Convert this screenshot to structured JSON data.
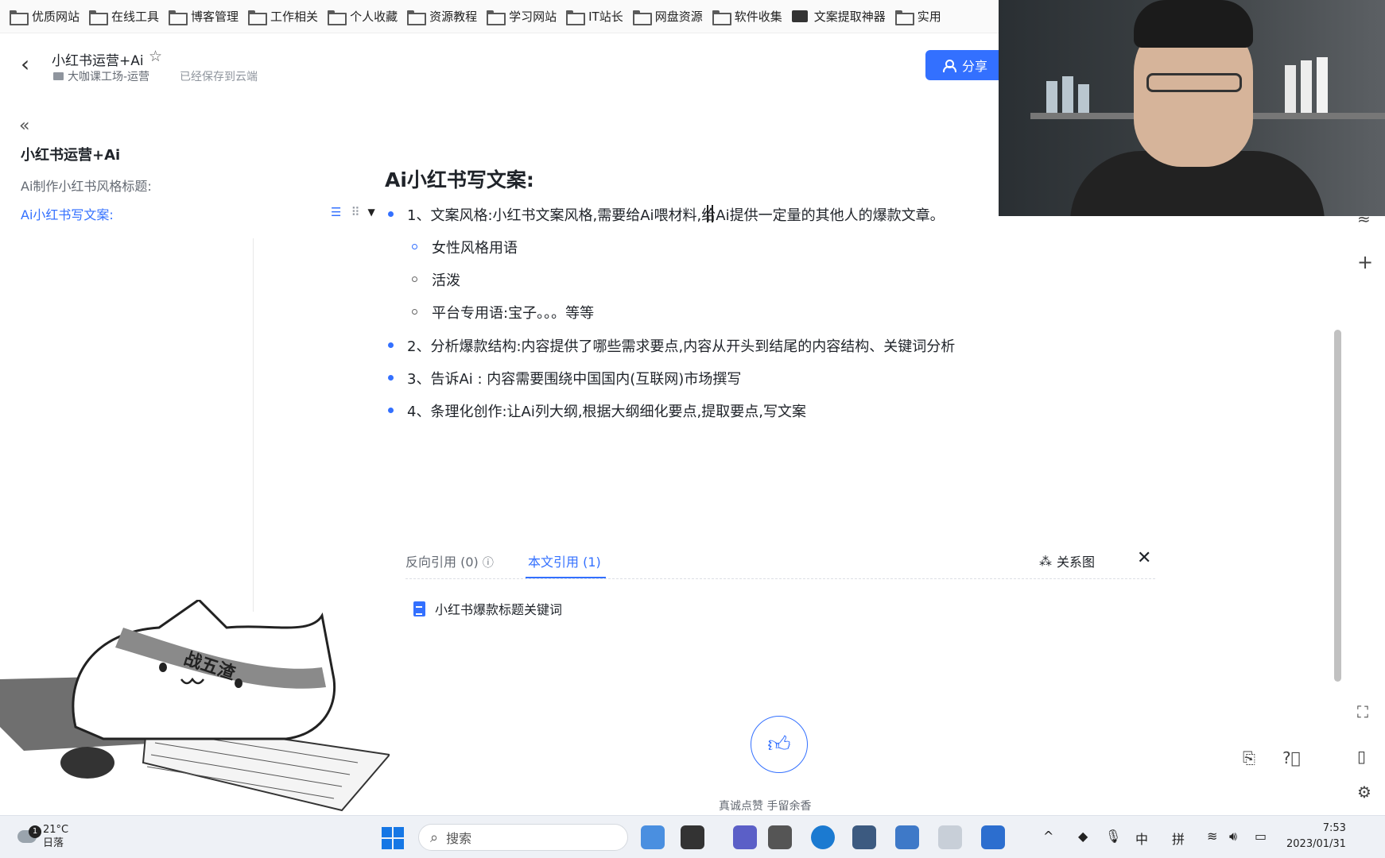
{
  "bookmarks": [
    {
      "label": "优质网站",
      "icon": "folder-icon"
    },
    {
      "label": "在线工具",
      "icon": "folder-icon"
    },
    {
      "label": "博客管理",
      "icon": "folder-icon"
    },
    {
      "label": "工作相关",
      "icon": "folder-icon"
    },
    {
      "label": "个人收藏",
      "icon": "folder-icon"
    },
    {
      "label": "资源教程",
      "icon": "folder-icon"
    },
    {
      "label": "学习网站",
      "icon": "folder-icon"
    },
    {
      "label": "IT站长",
      "icon": "folder-icon"
    },
    {
      "label": "网盘资源",
      "icon": "folder-icon"
    },
    {
      "label": "软件收集",
      "icon": "folder-icon"
    },
    {
      "label": "文案提取神器",
      "icon": "app-icon"
    },
    {
      "label": "实用",
      "icon": "folder-icon"
    }
  ],
  "header": {
    "doc_title": "小红书运营+Ai",
    "breadcrumb": "大咖课工场-运营",
    "save_status": "已经保存到云端",
    "share_label": "分享"
  },
  "sidebar": {
    "collapse": "«",
    "title": "小红书运营+Ai",
    "items": [
      {
        "label": "Ai制作小红书风格标题:"
      },
      {
        "label": "Ai小红书写文案:"
      }
    ]
  },
  "editor": {
    "heading": "Ai小红书写文案:",
    "items": [
      {
        "text": "1、文案风格:小红书文案风格,需要给Ai喂材料,给Ai提供一定量的其他人的爆款文章。"
      },
      {
        "text": "女性风格用语"
      },
      {
        "text": "活泼"
      },
      {
        "text": "平台专用语:宝子。。。等等"
      },
      {
        "text": "2、分析爆款结构:内容提供了哪些需求要点,内容从开头到结尾的内容结构、关键词分析"
      },
      {
        "text": "3、告诉Ai : 内容需要围绕中国国内(互联网)市场撰写"
      },
      {
        "text": "4、条理化创作:让Ai列大纲,根据大纲细化要点,提取要点,写文案"
      }
    ]
  },
  "references": {
    "backlinks_tab": "反向引用 (0)",
    "mentions_tab": "本文引用 (1)",
    "graph_label": "关系图",
    "linked_doc": "小红书爆款标题关键词"
  },
  "like": {
    "caption": "真诚点赞  手留余香"
  },
  "sticker": {
    "headband_text": "战五渣"
  },
  "taskbar": {
    "temperature": "21°C",
    "weather_text": "日落",
    "weather_badge": "1",
    "search_placeholder": "搜索",
    "ime_lang": "中",
    "ime_mode": "拼",
    "time": "7:53",
    "date": "2023/01/31"
  },
  "colors": {
    "accent": "#3370ff",
    "text": "#1f2329",
    "muted": "#646a73"
  }
}
